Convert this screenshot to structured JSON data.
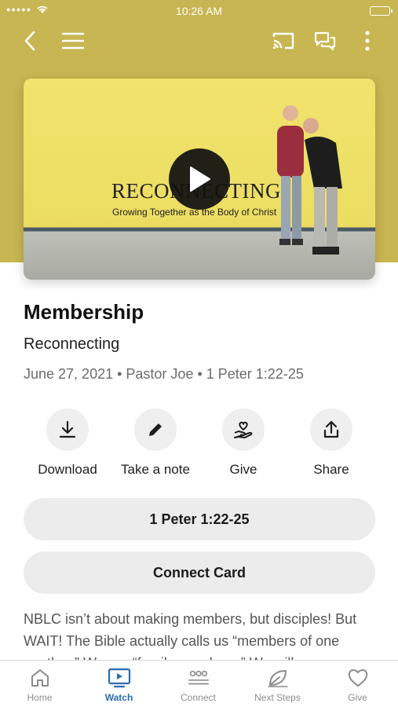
{
  "status_bar": {
    "time": "10:26 AM"
  },
  "nav": {
    "icons": [
      "back-icon",
      "menu-icon",
      "cast-icon",
      "chat-icon",
      "more-icon"
    ]
  },
  "video": {
    "title": "RECONNECTING",
    "subtitle": "Growing Together as the Body of Christ"
  },
  "sermon": {
    "title": "Membership",
    "series": "Reconnecting",
    "meta": "June 27, 2021 • Pastor Joe • 1 Peter 1:22-25"
  },
  "actions": [
    {
      "label": "Download",
      "icon": "download-icon"
    },
    {
      "label": "Take a note",
      "icon": "pencil-icon"
    },
    {
      "label": "Give",
      "icon": "give-hand-icon"
    },
    {
      "label": "Share",
      "icon": "share-icon"
    }
  ],
  "buttons": {
    "scripture": "1 Peter 1:22-25",
    "connect_card": "Connect Card"
  },
  "description": "NBLC isn’t about making members, but disciples! But WAIT! The Bible actually calls us “members of one another.” We are “family members.” We will",
  "tabs": [
    {
      "label": "Home",
      "icon": "home-icon"
    },
    {
      "label": "Watch",
      "icon": "tv-play-icon",
      "active": true
    },
    {
      "label": "Connect",
      "icon": "people-icon"
    },
    {
      "label": "Next Steps",
      "icon": "leaf-icon"
    },
    {
      "label": "Give",
      "icon": "heart-icon"
    }
  ],
  "colors": {
    "hero_background": "#c8b652",
    "active_tab": "#2a6cb0",
    "button_background": "#ececec"
  }
}
